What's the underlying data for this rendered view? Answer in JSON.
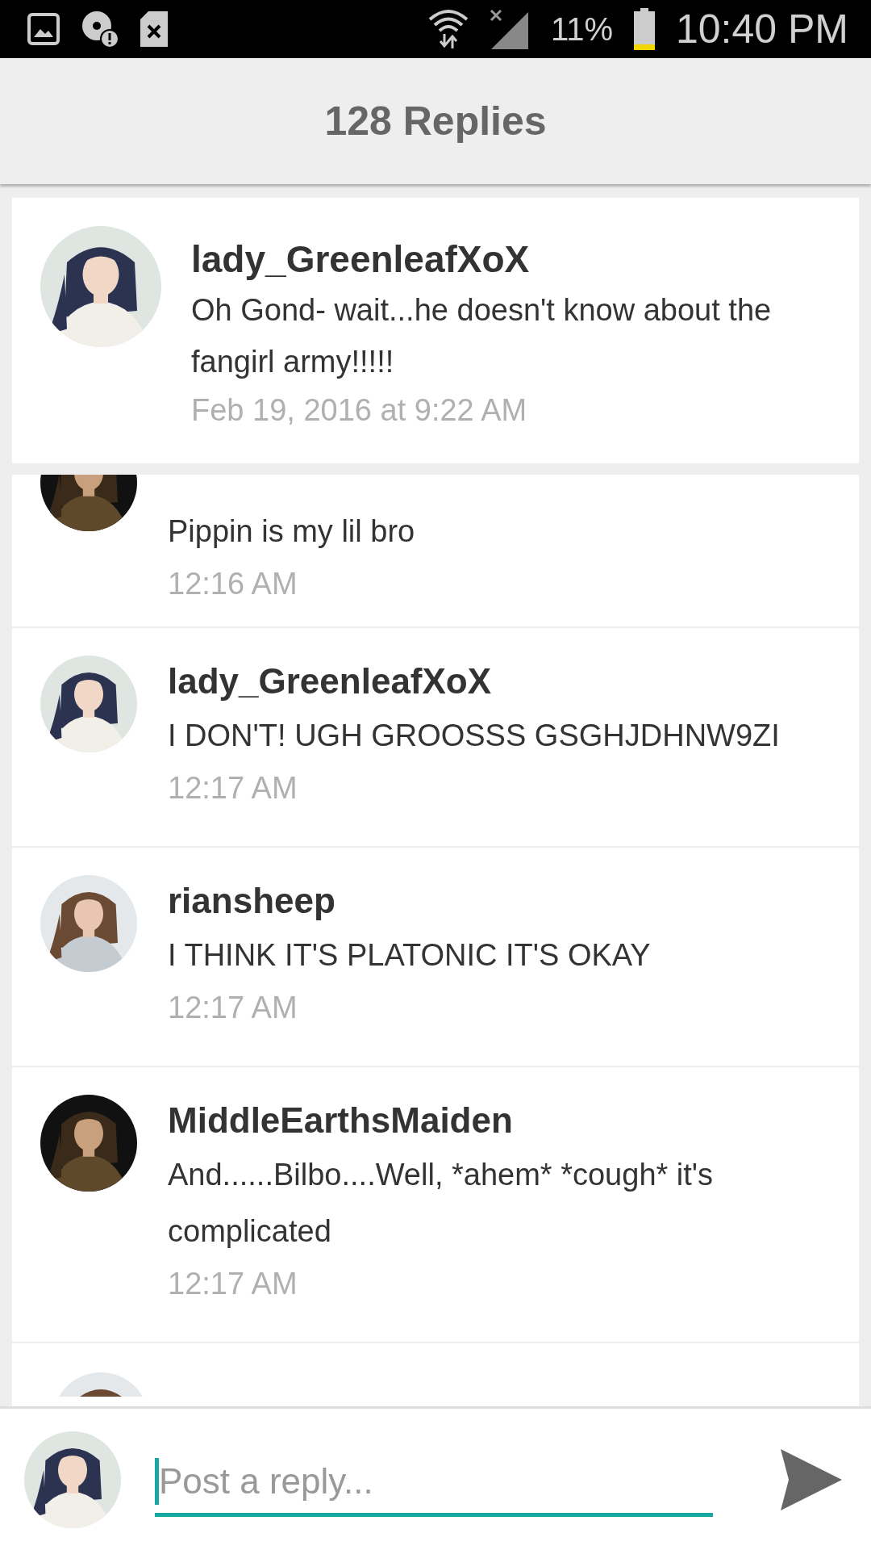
{
  "status_bar": {
    "battery": "11%",
    "time": "10:40 PM"
  },
  "header": {
    "title": "128 Replies"
  },
  "original_post": {
    "author": "lady_GreenleafXoX",
    "text": "Oh Gond- wait...he doesn't know about the fangirl army!!!!!",
    "time": "Feb 19, 2016 at 9:22 AM"
  },
  "replies": [
    {
      "kind": "tail",
      "text": "Pippin is my lil bro",
      "time": "12:16 AM"
    },
    {
      "kind": "full",
      "author": "lady_GreenleafXoX",
      "text": "I DON'T! UGH GROOSSS GSGHJDHNW9ZI",
      "time": "12:17 AM"
    },
    {
      "kind": "full",
      "author": "riansheep",
      "text": "I THINK IT'S PLATONIC IT'S OKAY",
      "time": "12:17 AM"
    },
    {
      "kind": "full",
      "author": "MiddleEarthsMaiden",
      "text": "And......Bilbo....Well, *ahem* *cough* it's complicated",
      "time": "12:17 AM"
    },
    {
      "kind": "peek"
    }
  ],
  "composer": {
    "placeholder": "Post a reply..."
  }
}
